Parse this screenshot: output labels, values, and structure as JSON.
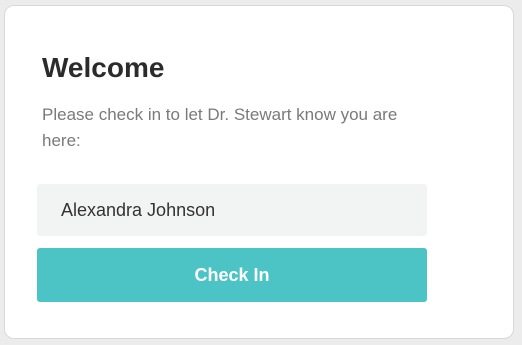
{
  "checkin": {
    "title": "Welcome",
    "message": "Please check in to let Dr. Stewart know you are here:",
    "name_value": "Alexandra Johnson",
    "button_label": "Check In"
  },
  "colors": {
    "accent": "#4cc3c5",
    "field_background": "#f2f3f3",
    "title_text": "#2b2b2b",
    "message_text": "#7a7a7a"
  }
}
